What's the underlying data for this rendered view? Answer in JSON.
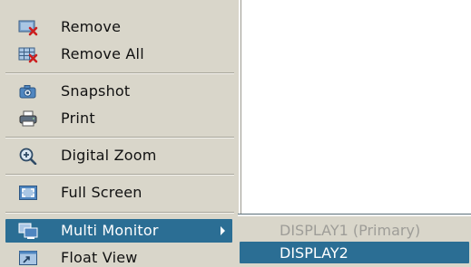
{
  "context_menu": {
    "items": [
      {
        "label": "Remove",
        "icon": "remove-icon"
      },
      {
        "label": "Remove All",
        "icon": "remove-all-icon"
      },
      {
        "label": "Snapshot",
        "icon": "camera-icon"
      },
      {
        "label": "Print",
        "icon": "printer-icon"
      },
      {
        "label": "Digital Zoom",
        "icon": "zoom-in-icon"
      },
      {
        "label": "Full Screen",
        "icon": "full-screen-icon"
      },
      {
        "label": "Multi Monitor",
        "icon": "multi-monitor-icon",
        "has_submenu": true,
        "active": true
      },
      {
        "label": "Float View",
        "icon": "float-view-icon"
      }
    ]
  },
  "multi_monitor_submenu": {
    "items": [
      {
        "label": "DISPLAY1 (Primary)",
        "enabled": false
      },
      {
        "label": "DISPLAY2",
        "enabled": true,
        "selected": true
      }
    ]
  },
  "colors": {
    "menu_background": "#d9d6ca",
    "highlight": "#2b6e94",
    "disabled_text": "#9e9d98",
    "remove_x": "#cc1f1f",
    "icon_blue": "#3a78b8"
  }
}
